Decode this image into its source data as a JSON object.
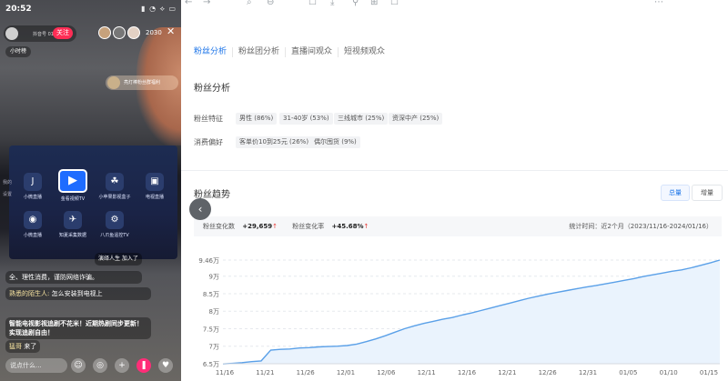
{
  "phone": {
    "time": "20:52",
    "status_icons": "▮ ◔ ⟡ ▭",
    "host_tag": "抖音号 01",
    "follow_label": "关注",
    "viewer_count": "2030",
    "close_glyph": "✕",
    "small_card": "小时榜",
    "gift_text": "亮灯棒粉丝群福利",
    "apps": [
      {
        "label": "小微直播",
        "glyph": "J"
      },
      {
        "label": "金看视频TV",
        "glyph": "▶"
      },
      {
        "label": "小苹果影视盒子",
        "glyph": "☘"
      },
      {
        "label": "电视直播",
        "glyph": "▣"
      },
      {
        "label": "小微直播",
        "glyph": "◉"
      },
      {
        "label": "知夏采集数据",
        "glyph": "✈"
      },
      {
        "label": "八爪鱼遥控TV",
        "glyph": "⚙"
      }
    ],
    "side_labels": [
      "我的",
      "设置"
    ],
    "bubble_join": "演绎人生 加入了",
    "bubble_notice": "全、理性消费，谨防网络诈骗。",
    "bubble_q_user": "熟悉的陌生人:",
    "bubble_q_text": "怎么安装到电视上",
    "bubble_promo": "智能电视影视追剧不花米！近期热剧同步更新！实现追剧自由！",
    "bubble_come_user": "猛哥",
    "bubble_come_text": "来了",
    "comment_placeholder": "说点什么...",
    "bottom_icons": [
      "☺",
      "◎",
      "+",
      "❚",
      "♥"
    ]
  },
  "browser": {
    "toolbar_icons": [
      "←",
      "→",
      "↻",
      "⌕",
      "⊖",
      "☐",
      "⤓",
      "⚲",
      "⊞",
      "☐",
      "⋯"
    ],
    "tabs": [
      {
        "label": "粉丝分析",
        "active": true
      },
      {
        "label": "粉丝团分析",
        "active": false
      },
      {
        "label": "直播间观众",
        "active": false
      },
      {
        "label": "短视频观众",
        "active": false
      }
    ],
    "section_title": "粉丝分析",
    "traits_label": "粉丝特征",
    "traits": [
      "男性 (86%)",
      "31-40岁 (53%)",
      "三线城市 (25%)",
      "资深中产 (25%)"
    ],
    "consumption_label": "消费偏好",
    "consumption": [
      "客单价10到25元 (26%)",
      "偶尔囤货 (9%)"
    ],
    "trend_title": "粉丝趋势",
    "toggle_total": "总量",
    "toggle_increase": "增量",
    "change_count_label": "粉丝变化数",
    "change_count_value": "+29,659",
    "change_rate_label": "粉丝变化率",
    "change_rate_value": "+45.68%",
    "up_arrow": "↑",
    "period_text": "统计时间：近2个月（2023/11/16-2024/01/16）",
    "prev_glyph": "‹"
  },
  "chart_data": {
    "type": "area",
    "title": "",
    "xlabel": "",
    "ylabel": "",
    "x_ticks": [
      "11/16",
      "11/21",
      "11/26",
      "12/01",
      "12/06",
      "12/11",
      "12/16",
      "12/21",
      "12/26",
      "12/31",
      "01/05",
      "01/10",
      "01/15"
    ],
    "y_ticks": [
      {
        "label": "6.5万",
        "value": 65000
      },
      {
        "label": "7万",
        "value": 70000
      },
      {
        "label": "7.5万",
        "value": 75000
      },
      {
        "label": "8万",
        "value": 80000
      },
      {
        "label": "8.5万",
        "value": 85000
      },
      {
        "label": "9万",
        "value": 90000
      },
      {
        "label": "9.46万",
        "value": 94600
      }
    ],
    "ylim": [
      65000,
      94600
    ],
    "grid": true,
    "line_color": "#5aa0e8",
    "fill_color": "#eaf3fd",
    "series": [
      {
        "values": [
          64950,
          65100,
          65300,
          65600,
          65800,
          68900,
          69100,
          69200,
          69500,
          69600,
          69800,
          69900,
          70000,
          70200,
          70600,
          71300,
          72100,
          73000,
          74000,
          75000,
          75800,
          76500,
          77100,
          77700,
          78200,
          78900,
          79500,
          80200,
          80900,
          81600,
          82300,
          83000,
          83700,
          84300,
          84900,
          85400,
          85900,
          86400,
          86900,
          87300,
          87800,
          88300,
          88800,
          89300,
          89900,
          90400,
          90900,
          91400,
          91800,
          92400,
          93100,
          93800,
          94600
        ]
      }
    ]
  }
}
